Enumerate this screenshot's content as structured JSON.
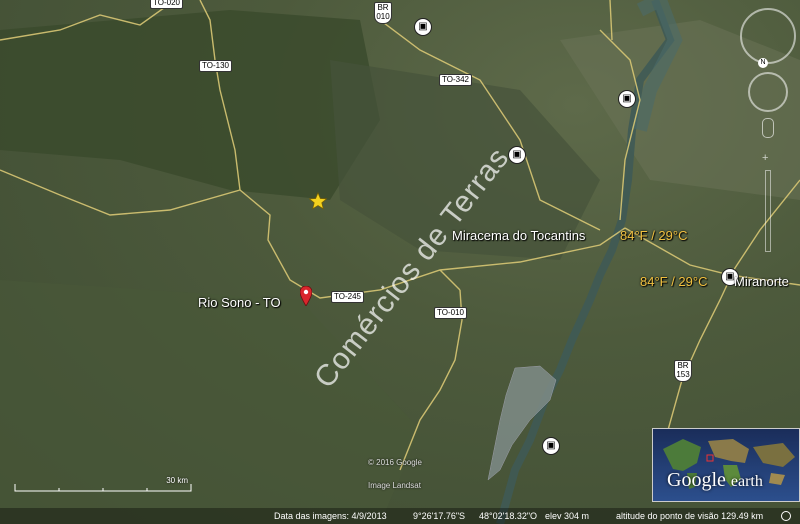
{
  "places": {
    "rio_sono": "Rio Sono - TO",
    "miracema": "Miracema do Tocantins",
    "miranorte": "Miranorte"
  },
  "temps": {
    "miracema": "84°F / 29°C",
    "miranorte": "84°F / 29°C"
  },
  "roads": {
    "to020": "TO-020",
    "to130": "TO-130",
    "to342": "TO-342",
    "to245": "TO-245",
    "to010": "TO-010",
    "br010_top": "BR",
    "br010_num": "010",
    "br153_top": "BR",
    "br153_num": "153"
  },
  "watermark": "Comércios de Terras",
  "credits": {
    "copyright": "© 2016 Google",
    "image": "Image Landsat"
  },
  "scale": "30 km",
  "status": {
    "date": "Data das imagens: 4/9/2013",
    "lat": "9°26'17.76\"S",
    "lon": "48°02'18.32\"O",
    "elev": "elev   304 m",
    "alt": "altitude do ponto de visão 129.49 km"
  },
  "logo": {
    "google": "Google",
    "earth": "earth"
  }
}
